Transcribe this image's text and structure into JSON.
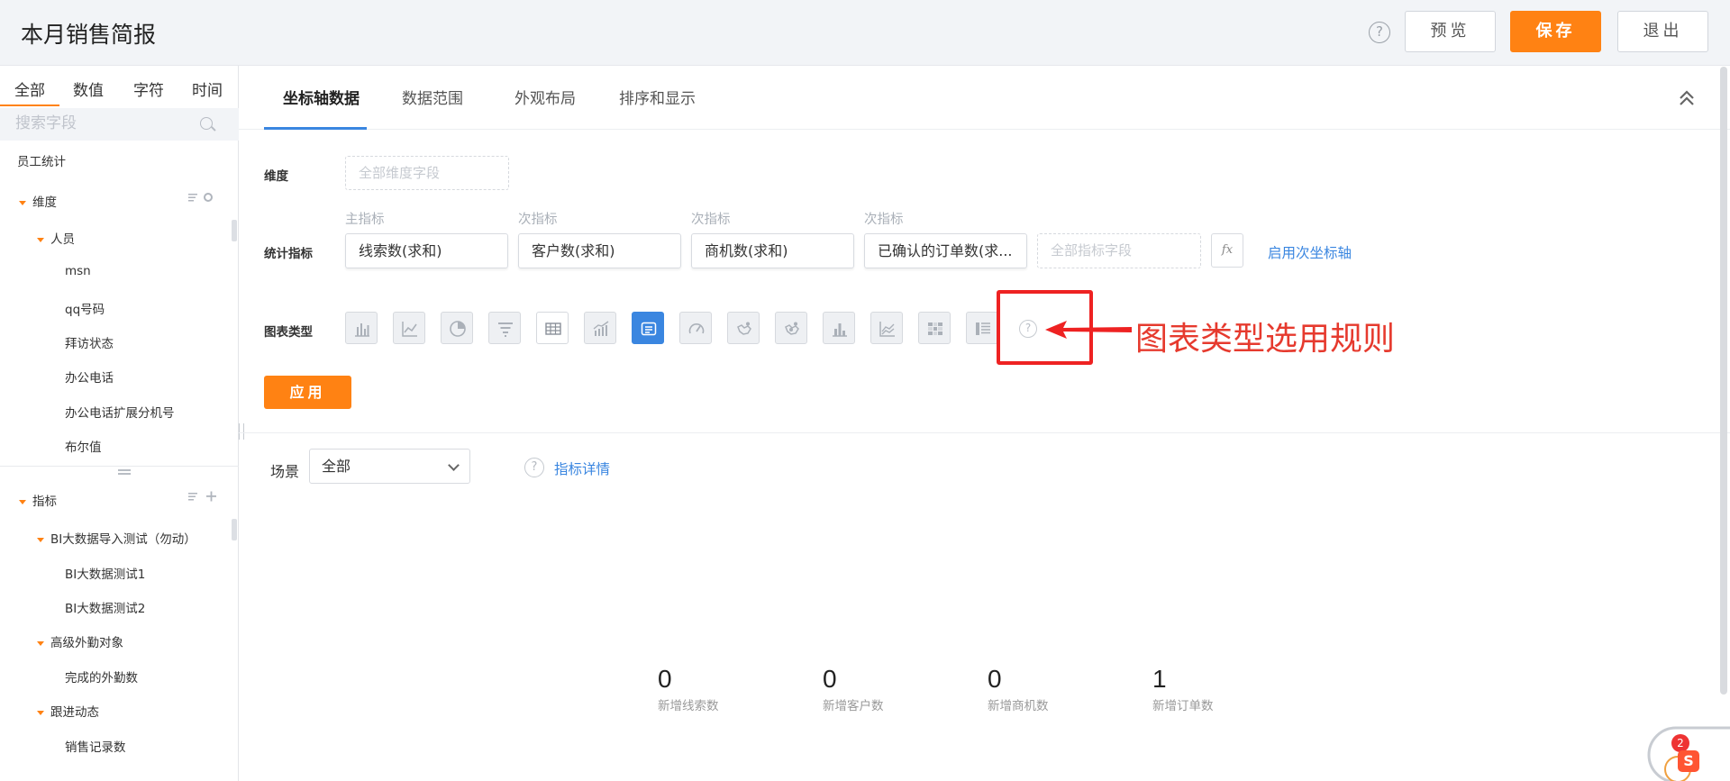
{
  "header": {
    "title": "本月销售简报",
    "help_glyph": "?",
    "preview_label": "预览",
    "save_label": "保存",
    "exit_label": "退出"
  },
  "left_panel": {
    "tabs": [
      "全部",
      "数值",
      "字符",
      "时间"
    ],
    "search_placeholder": "搜索字段",
    "dataset": "员工统计",
    "dimension_group": "维度",
    "person_group": "人员",
    "person_fields": [
      "msn",
      "qq号码",
      "拜访状态",
      "办公电话",
      "办公电话扩展分机号",
      "布尔值"
    ],
    "metric_group": "指标",
    "metric_subgroups": [
      {
        "label": "BI大数据导入测试（勿动）",
        "items": [
          "BI大数据测试1",
          "BI大数据测试2"
        ]
      },
      {
        "label": "高级外勤对象",
        "items": [
          "完成的外勤数"
        ]
      },
      {
        "label": "跟进动态",
        "items": [
          "销售记录数"
        ]
      }
    ]
  },
  "main": {
    "tabs": [
      "坐标轴数据",
      "数据范围",
      "外观布局",
      "排序和显示"
    ],
    "dimension_label": "维度",
    "dimension_placeholder": "全部维度字段",
    "metrics_label": "统计指标",
    "metric_captions": [
      "主指标",
      "次指标",
      "次指标",
      "次指标"
    ],
    "metric_values": [
      "线索数(求和)",
      "客户数(求和)",
      "商机数(求和)",
      "已确认的订单数(求..."
    ],
    "metric_placeholder": "全部指标字段",
    "fx_label": "fx",
    "secondary_axis_link": "启用次坐标轴",
    "chart_type_label": "图表类型",
    "chart_help_glyph": "?",
    "apply_label": "应用",
    "annotation_text": "图表类型选用规则",
    "scene_label": "场景",
    "scene_value": "全部",
    "info_glyph": "?",
    "metric_detail_link": "指标详情",
    "stats": [
      {
        "value": "0",
        "label": "新增线索数"
      },
      {
        "value": "0",
        "label": "新增客户数"
      },
      {
        "value": "0",
        "label": "新增商机数"
      },
      {
        "value": "1",
        "label": "新增订单数"
      }
    ],
    "widget_badge": "2",
    "widget_logo": "S"
  }
}
